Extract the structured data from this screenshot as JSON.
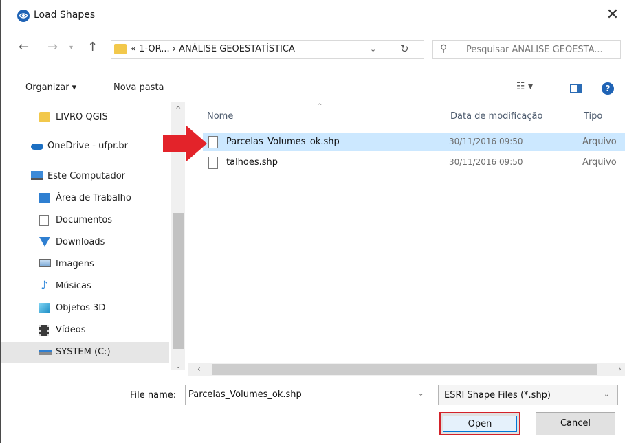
{
  "window": {
    "title": "Load Shapes",
    "close_glyph": "✕"
  },
  "navigation": {
    "back_glyph": "←",
    "forward_glyph": "→",
    "dropdown_glyph": "▾",
    "up_glyph": "↑",
    "address": "« 1-OR... › ANÁLISE GEOESTATÍSTICA",
    "address_dropdown_glyph": "⌄",
    "refresh_glyph": "↻",
    "search_glyph": "⚲",
    "search_placeholder": "Pesquisar ANÁLISE GEOESTA..."
  },
  "toolbar": {
    "organize_label": "Organizar ▾",
    "new_folder_label": "Nova pasta",
    "view_glyph": "☷ ▾",
    "help_glyph": "?"
  },
  "sidebar": {
    "items": [
      {
        "label": "LIVRO QGIS",
        "icon": "folder-icon"
      },
      {
        "label": "OneDrive - ufpr.br",
        "icon": "cloud-icon"
      },
      {
        "label": "Este Computador",
        "icon": "computer-icon"
      },
      {
        "label": "Área de Trabalho",
        "icon": "desktop-icon"
      },
      {
        "label": "Documentos",
        "icon": "documents-icon"
      },
      {
        "label": "Downloads",
        "icon": "download-icon"
      },
      {
        "label": "Imagens",
        "icon": "pictures-icon"
      },
      {
        "label": "Músicas",
        "icon": "music-icon"
      },
      {
        "label": "Objetos 3D",
        "icon": "3d-objects-icon"
      },
      {
        "label": "Vídeos",
        "icon": "videos-icon"
      },
      {
        "label": "SYSTEM (C:)",
        "icon": "drive-icon"
      }
    ],
    "selected": "SYSTEM (C:)"
  },
  "file_list": {
    "columns": [
      "Nome",
      "Data de modificação",
      "Tipo"
    ],
    "sort_glyph": "^",
    "rows": [
      {
        "name": "Parcelas_Volumes_ok.shp",
        "modified": "30/11/2016 09:50",
        "type": "Arquivo",
        "selected": true
      },
      {
        "name": "talhoes.shp",
        "modified": "30/11/2016 09:50",
        "type": "Arquivo",
        "selected": false
      }
    ]
  },
  "scrollbars": {
    "up_glyph": "^",
    "down_glyph": "⌄",
    "left_glyph": "‹",
    "right_glyph": "›"
  },
  "bottom": {
    "file_name_label": "File name:",
    "file_name_value": "Parcelas_Volumes_ok.shp",
    "filter_value": "ESRI Shape Files (*.shp)",
    "dropdown_glyph": "⌄",
    "open_label": "Open",
    "cancel_label": "Cancel"
  },
  "colors": {
    "selection": "#cce8ff",
    "annotation_red": "#e3232a",
    "accent_blue": "#1f63b5"
  }
}
